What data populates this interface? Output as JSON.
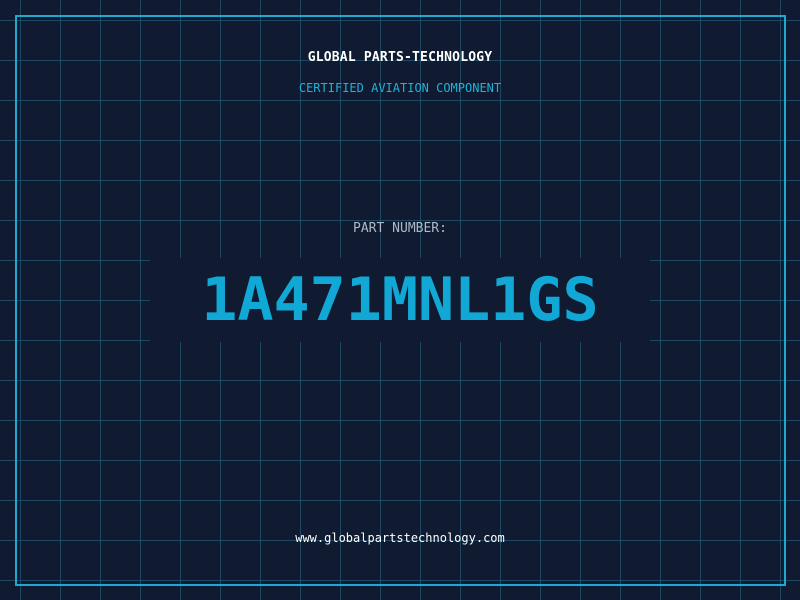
{
  "header": {
    "company": "GLOBAL PARTS-TECHNOLOGY",
    "subtitle": "CERTIFIED AVIATION COMPONENT"
  },
  "part": {
    "label": "PART NUMBER:",
    "number": "1A471MNL1GS"
  },
  "footer": {
    "website": "www.globalpartstechnology.com"
  },
  "colors": {
    "background": "#101a30",
    "grid": "#266e8c",
    "accent": "#1fa8d0",
    "text": "#ffffff",
    "muted": "#aeb9c8"
  }
}
